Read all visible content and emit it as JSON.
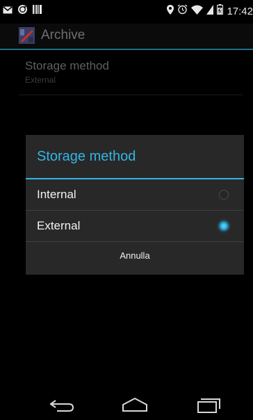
{
  "status_bar": {
    "time": "17:42",
    "left_icons": [
      "gmail-icon",
      "sync-icon",
      "barcode-icon"
    ],
    "right_icons": [
      "location-icon",
      "alarm-icon",
      "wifi-icon",
      "signal-icon",
      "battery-icon"
    ]
  },
  "action_bar": {
    "title": "Archive",
    "logo_icon": "app-logo-icon"
  },
  "preference": {
    "title": "Storage method",
    "summary": "External"
  },
  "dialog": {
    "title": "Storage method",
    "options": [
      {
        "label": "Internal",
        "selected": false
      },
      {
        "label": "External",
        "selected": true
      }
    ],
    "cancel_label": "Annulla",
    "accent_color": "#33b5e5"
  },
  "nav_bar": {
    "buttons": [
      "back-icon",
      "home-icon",
      "recents-icon"
    ]
  }
}
